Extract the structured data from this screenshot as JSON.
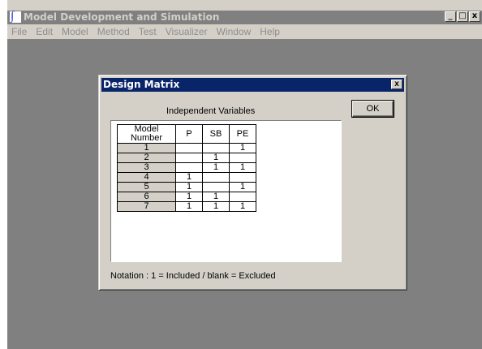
{
  "app": {
    "title": "Model Development and Simulation",
    "icon": "model-dev-app-icon",
    "window_buttons": [
      "_",
      "□",
      "x"
    ]
  },
  "menu": [
    "File",
    "Edit",
    "Model",
    "Method",
    "Test",
    "Visualizer",
    "Window",
    "Help"
  ],
  "dialog": {
    "title": "Design Matrix",
    "close_label": "x",
    "group_label": "Independent Variables",
    "ok_label": "OK",
    "table": {
      "headers": [
        "Model Number",
        "P",
        "SB",
        "PE"
      ],
      "rows": [
        [
          "1",
          "",
          "",
          "1"
        ],
        [
          "2",
          "",
          "1",
          ""
        ],
        [
          "3",
          "",
          "1",
          "1"
        ],
        [
          "4",
          "1",
          "",
          ""
        ],
        [
          "5",
          "1",
          "",
          "1"
        ],
        [
          "6",
          "1",
          "1",
          ""
        ],
        [
          "7",
          "1",
          "1",
          "1"
        ]
      ]
    },
    "notation": "Notation :  1 = Included   /   blank = Excluded"
  },
  "colors": {
    "active_titlebar": "#0a246a",
    "inactive_titlebar": "#808080",
    "workspace": "#808080",
    "face": "#d4d0c8"
  }
}
